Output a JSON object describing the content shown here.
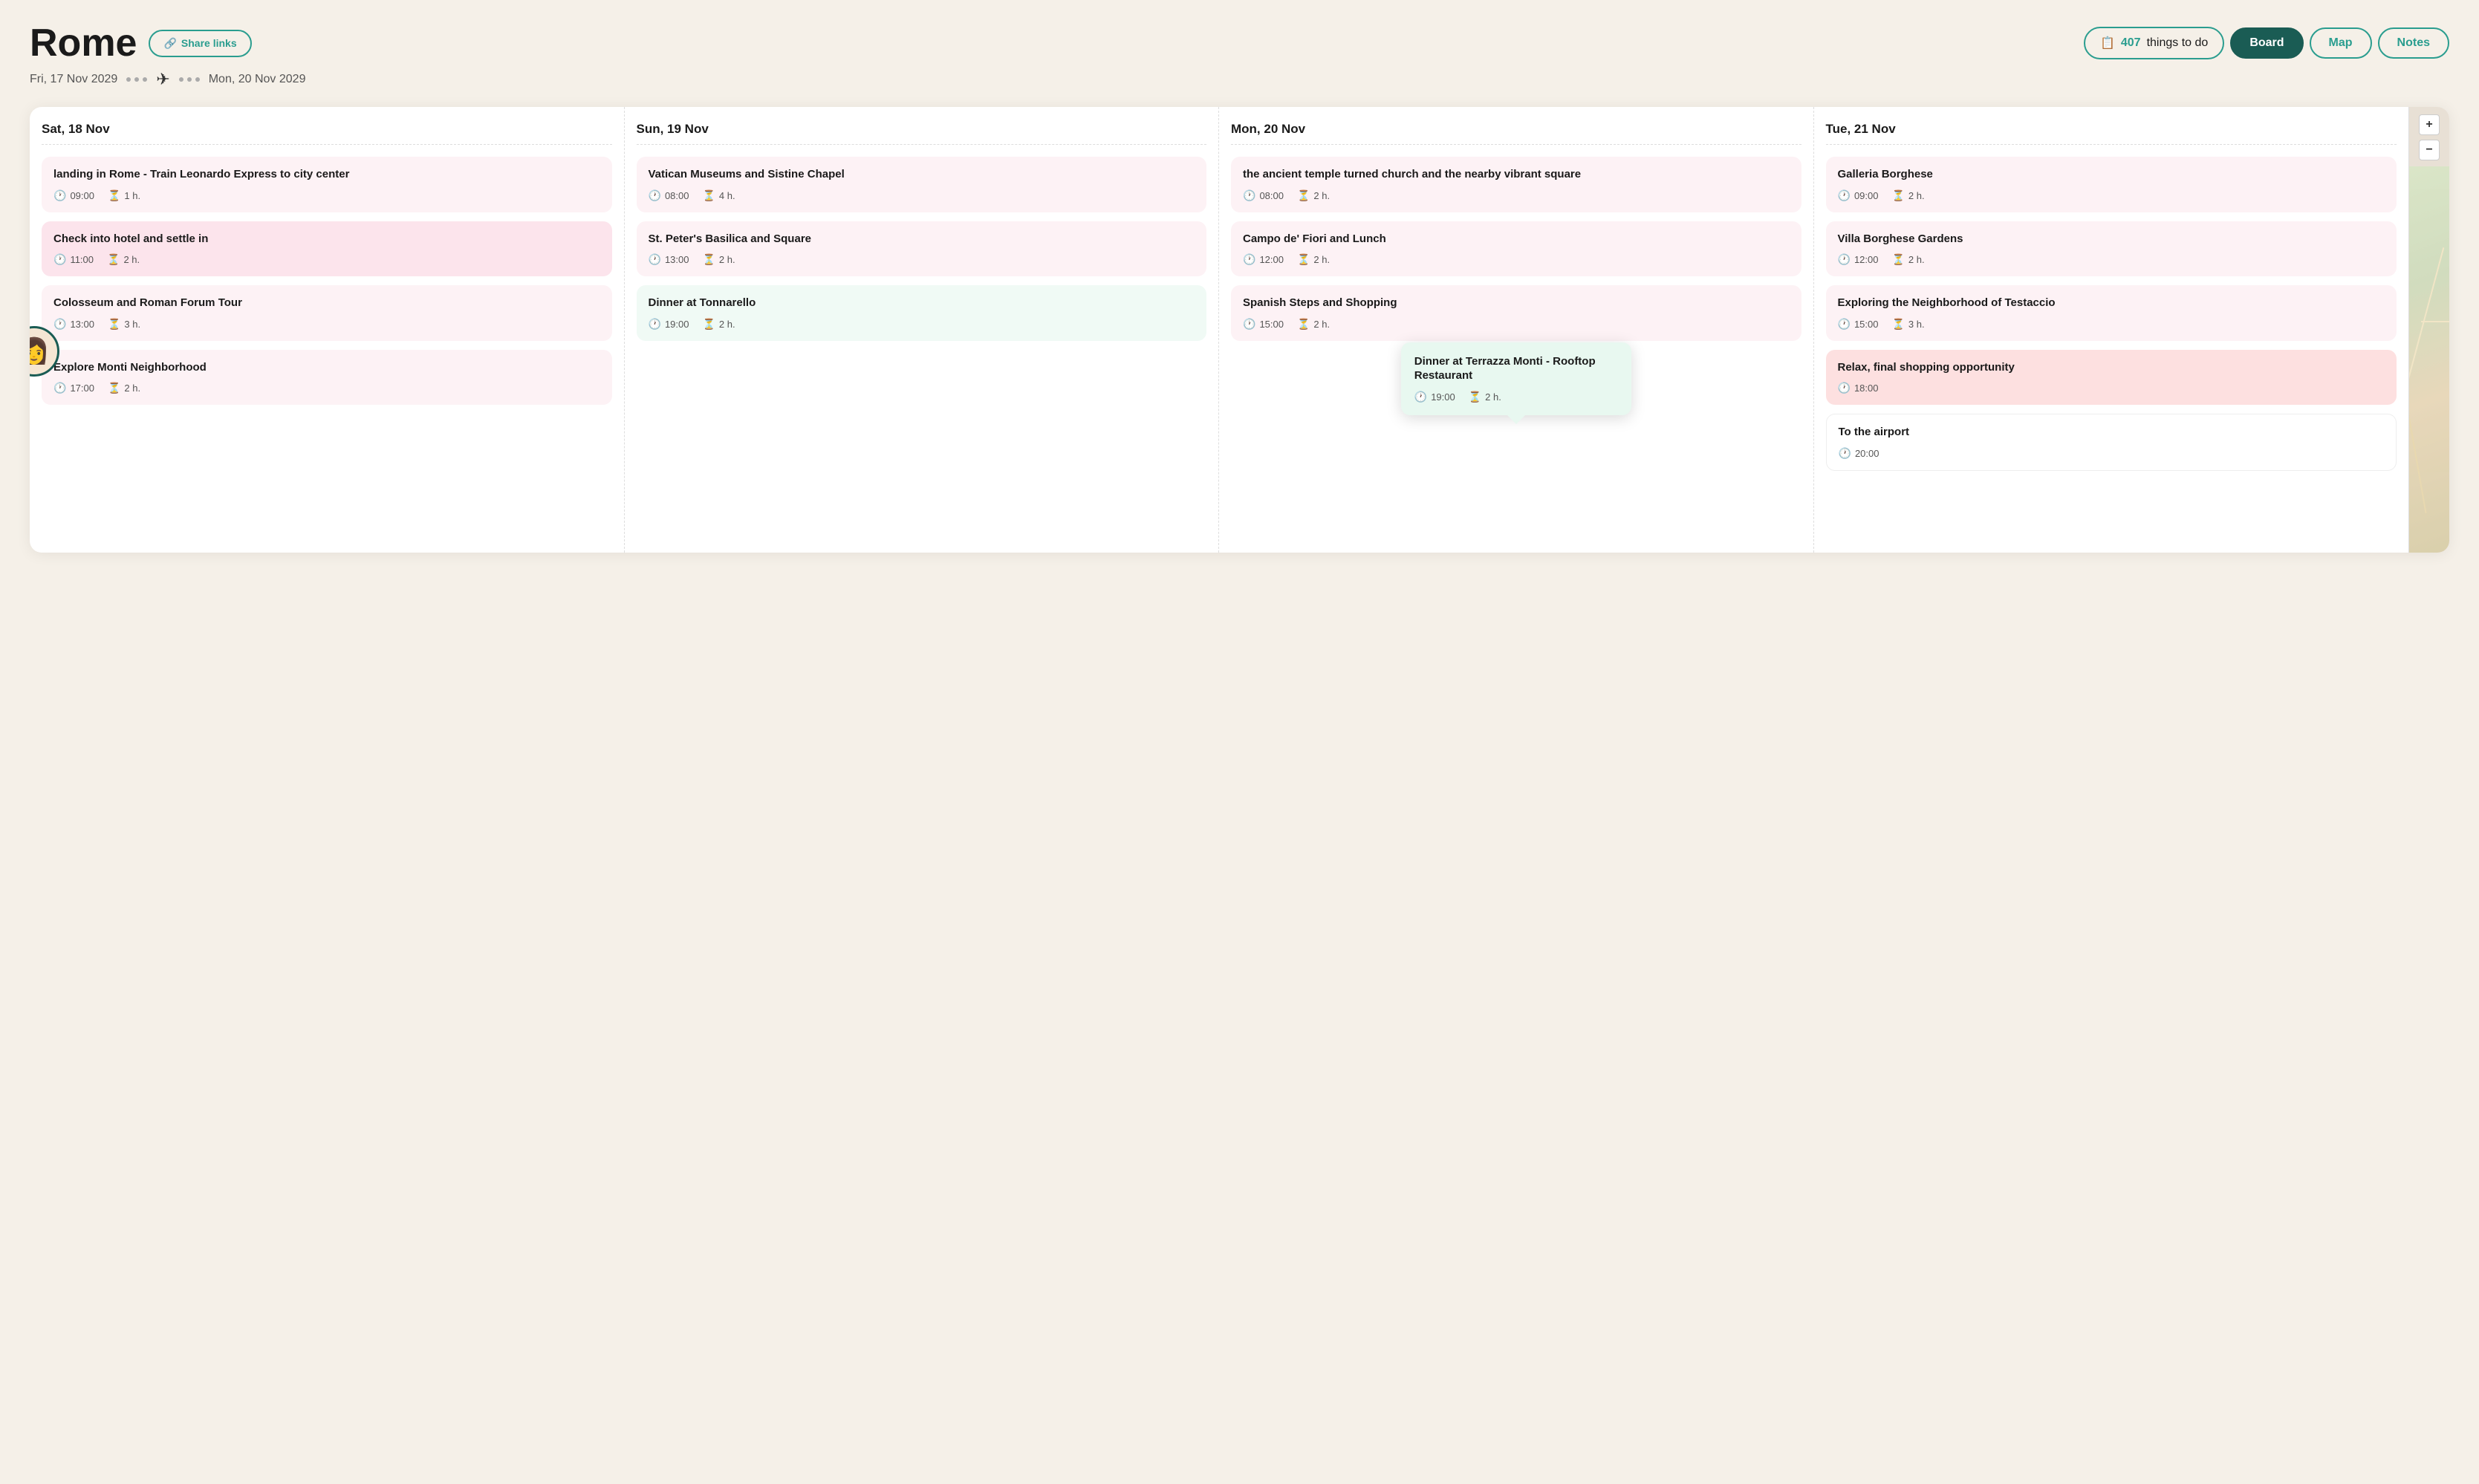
{
  "header": {
    "city": "Rome",
    "share_label": "Share links",
    "date_start": "Fri, 17 Nov 2029",
    "date_end": "Mon, 20 Nov 2029",
    "things_count": "407",
    "things_label": "things to do",
    "tabs": [
      {
        "id": "board",
        "label": "Board",
        "active": true
      },
      {
        "id": "map",
        "label": "Map",
        "active": false
      },
      {
        "id": "notes",
        "label": "Notes",
        "active": false
      }
    ]
  },
  "columns": [
    {
      "id": "sat",
      "header": "Sat, 18 Nov",
      "cards": [
        {
          "id": "sat1",
          "title": "landing in Rome - Train Leonardo Express to city center",
          "time": "09:00",
          "duration": "1 h.",
          "color": "pink"
        },
        {
          "id": "sat2",
          "title": "Check into hotel and settle in",
          "time": "11:00",
          "duration": "2 h.",
          "color": "pink"
        },
        {
          "id": "sat3",
          "title": "Colosseum and Roman Forum Tour",
          "time": "13:00",
          "duration": "3 h.",
          "color": "pink"
        },
        {
          "id": "sat4",
          "title": "Explore Monti Neighborhood",
          "time": "17:00",
          "duration": "2 h.",
          "color": "pink"
        }
      ]
    },
    {
      "id": "sun",
      "header": "Sun, 19 Nov",
      "cards": [
        {
          "id": "sun1",
          "title": "Vatican Museums and Sistine Chapel",
          "time": "08:00",
          "duration": "4 h.",
          "color": "pink"
        },
        {
          "id": "sun2",
          "title": "St. Peter's Basilica and Square",
          "time": "13:00",
          "duration": "2 h.",
          "color": "pink"
        },
        {
          "id": "sun3",
          "title": "Dinner at Tonnarello",
          "time": "19:00",
          "duration": "2 h.",
          "color": "green"
        }
      ]
    },
    {
      "id": "mon",
      "header": "Mon, 20 Nov",
      "cards": [
        {
          "id": "mon1",
          "title": "the ancient temple turned church and the nearby vibrant square",
          "time": "08:00",
          "duration": "2 h.",
          "color": "pink"
        },
        {
          "id": "mon2",
          "title": "Campo de' Fiori and Lunch",
          "time": "12:00",
          "duration": "2 h.",
          "color": "pink"
        },
        {
          "id": "mon3",
          "title": "Spanish Steps and Shopping",
          "time": "15:00",
          "duration": "2 h.",
          "color": "pink"
        },
        {
          "id": "mon4",
          "title": "Dinner at Terrazza Monti - Rooftop Restaurant",
          "time": "19:00",
          "duration": "2 h.",
          "color": "green",
          "tooltip": true
        }
      ]
    },
    {
      "id": "tue",
      "header": "Tue, 21 Nov",
      "cards": [
        {
          "id": "tue1",
          "title": "Galleria Borghese",
          "time": "09:00",
          "duration": "2 h.",
          "color": "pink"
        },
        {
          "id": "tue2",
          "title": "Villa Borghese Gardens",
          "time": "12:00",
          "duration": "2 h.",
          "color": "pink"
        },
        {
          "id": "tue3",
          "title": "Exploring the Neighborhood of Testaccio",
          "time": "15:00",
          "duration": "3 h.",
          "color": "pink"
        },
        {
          "id": "tue4",
          "title": "Relax, final shopping opportunity",
          "time": "18:00",
          "duration": null,
          "color": "salmon"
        },
        {
          "id": "tue5",
          "title": "To the airport",
          "time": "20:00",
          "duration": null,
          "color": "white"
        }
      ]
    }
  ],
  "tooltip": {
    "title": "Dinner at Terrazza Monti - Rooftop Restaurant",
    "time": "19:00",
    "duration": "2 h."
  },
  "icons": {
    "clock": "🕐",
    "hourglass": "⏳",
    "link": "🔗",
    "plane": "✈",
    "checklist": "📋"
  }
}
